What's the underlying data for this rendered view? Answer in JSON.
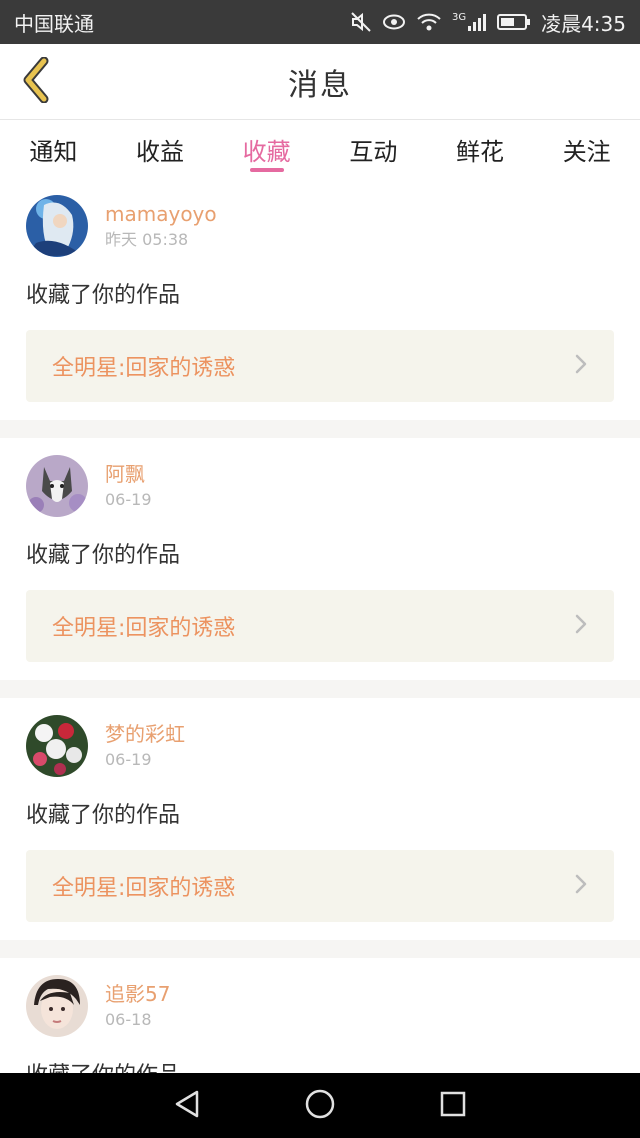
{
  "status_bar": {
    "carrier": "中国联通",
    "network": "3G",
    "time": "凌晨4:35"
  },
  "header": {
    "title": "消息"
  },
  "tabs": [
    {
      "label": "通知",
      "active": false
    },
    {
      "label": "收益",
      "active": false
    },
    {
      "label": "收藏",
      "active": true
    },
    {
      "label": "互动",
      "active": false
    },
    {
      "label": "鲜花",
      "active": false
    },
    {
      "label": "关注",
      "active": false
    }
  ],
  "messages": [
    {
      "user": "mamayoyo",
      "time": "昨天 05:38",
      "action": "收藏了你的作品",
      "work": "全明星:回家的诱惑"
    },
    {
      "user": "阿飘",
      "time": "06-19",
      "action": "收藏了你的作品",
      "work": "全明星:回家的诱惑"
    },
    {
      "user": "梦的彩虹",
      "time": "06-19",
      "action": "收藏了你的作品",
      "work": "全明星:回家的诱惑"
    },
    {
      "user": "追影57",
      "time": "06-18",
      "action": "收藏了你的作品",
      "work": ""
    }
  ],
  "colors": {
    "accent": "#e56aa0",
    "username": "#e8a070",
    "work_title": "#ec9360",
    "work_box_bg": "#f5f4ec",
    "back_arrow": "#e8c350"
  },
  "icons": {
    "back": "chevron-left-icon",
    "mute": "mute-icon",
    "eye": "eye-icon",
    "wifi": "wifi-icon",
    "signal": "signal-icon",
    "battery": "battery-icon",
    "work_arrow": "chevron-right-icon",
    "nav_back": "triangle-back-icon",
    "nav_home": "circle-home-icon",
    "nav_recents": "square-recents-icon"
  }
}
